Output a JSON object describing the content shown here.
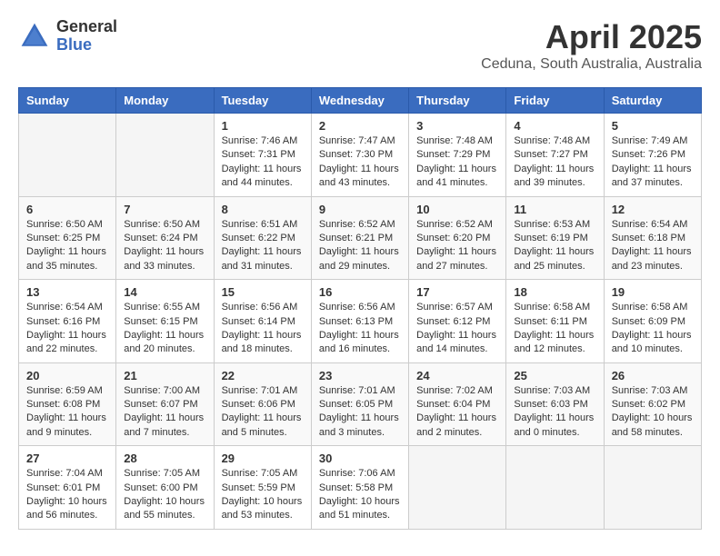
{
  "logo": {
    "general": "General",
    "blue": "Blue"
  },
  "header": {
    "title": "April 2025",
    "subtitle": "Ceduna, South Australia, Australia"
  },
  "weekdays": [
    "Sunday",
    "Monday",
    "Tuesday",
    "Wednesday",
    "Thursday",
    "Friday",
    "Saturday"
  ],
  "weeks": [
    [
      {
        "day": "",
        "detail": ""
      },
      {
        "day": "",
        "detail": ""
      },
      {
        "day": "1",
        "detail": "Sunrise: 7:46 AM\nSunset: 7:31 PM\nDaylight: 11 hours\nand 44 minutes."
      },
      {
        "day": "2",
        "detail": "Sunrise: 7:47 AM\nSunset: 7:30 PM\nDaylight: 11 hours\nand 43 minutes."
      },
      {
        "day": "3",
        "detail": "Sunrise: 7:48 AM\nSunset: 7:29 PM\nDaylight: 11 hours\nand 41 minutes."
      },
      {
        "day": "4",
        "detail": "Sunrise: 7:48 AM\nSunset: 7:27 PM\nDaylight: 11 hours\nand 39 minutes."
      },
      {
        "day": "5",
        "detail": "Sunrise: 7:49 AM\nSunset: 7:26 PM\nDaylight: 11 hours\nand 37 minutes."
      }
    ],
    [
      {
        "day": "6",
        "detail": "Sunrise: 6:50 AM\nSunset: 6:25 PM\nDaylight: 11 hours\nand 35 minutes."
      },
      {
        "day": "7",
        "detail": "Sunrise: 6:50 AM\nSunset: 6:24 PM\nDaylight: 11 hours\nand 33 minutes."
      },
      {
        "day": "8",
        "detail": "Sunrise: 6:51 AM\nSunset: 6:22 PM\nDaylight: 11 hours\nand 31 minutes."
      },
      {
        "day": "9",
        "detail": "Sunrise: 6:52 AM\nSunset: 6:21 PM\nDaylight: 11 hours\nand 29 minutes."
      },
      {
        "day": "10",
        "detail": "Sunrise: 6:52 AM\nSunset: 6:20 PM\nDaylight: 11 hours\nand 27 minutes."
      },
      {
        "day": "11",
        "detail": "Sunrise: 6:53 AM\nSunset: 6:19 PM\nDaylight: 11 hours\nand 25 minutes."
      },
      {
        "day": "12",
        "detail": "Sunrise: 6:54 AM\nSunset: 6:18 PM\nDaylight: 11 hours\nand 23 minutes."
      }
    ],
    [
      {
        "day": "13",
        "detail": "Sunrise: 6:54 AM\nSunset: 6:16 PM\nDaylight: 11 hours\nand 22 minutes."
      },
      {
        "day": "14",
        "detail": "Sunrise: 6:55 AM\nSunset: 6:15 PM\nDaylight: 11 hours\nand 20 minutes."
      },
      {
        "day": "15",
        "detail": "Sunrise: 6:56 AM\nSunset: 6:14 PM\nDaylight: 11 hours\nand 18 minutes."
      },
      {
        "day": "16",
        "detail": "Sunrise: 6:56 AM\nSunset: 6:13 PM\nDaylight: 11 hours\nand 16 minutes."
      },
      {
        "day": "17",
        "detail": "Sunrise: 6:57 AM\nSunset: 6:12 PM\nDaylight: 11 hours\nand 14 minutes."
      },
      {
        "day": "18",
        "detail": "Sunrise: 6:58 AM\nSunset: 6:11 PM\nDaylight: 11 hours\nand 12 minutes."
      },
      {
        "day": "19",
        "detail": "Sunrise: 6:58 AM\nSunset: 6:09 PM\nDaylight: 11 hours\nand 10 minutes."
      }
    ],
    [
      {
        "day": "20",
        "detail": "Sunrise: 6:59 AM\nSunset: 6:08 PM\nDaylight: 11 hours\nand 9 minutes."
      },
      {
        "day": "21",
        "detail": "Sunrise: 7:00 AM\nSunset: 6:07 PM\nDaylight: 11 hours\nand 7 minutes."
      },
      {
        "day": "22",
        "detail": "Sunrise: 7:01 AM\nSunset: 6:06 PM\nDaylight: 11 hours\nand 5 minutes."
      },
      {
        "day": "23",
        "detail": "Sunrise: 7:01 AM\nSunset: 6:05 PM\nDaylight: 11 hours\nand 3 minutes."
      },
      {
        "day": "24",
        "detail": "Sunrise: 7:02 AM\nSunset: 6:04 PM\nDaylight: 11 hours\nand 2 minutes."
      },
      {
        "day": "25",
        "detail": "Sunrise: 7:03 AM\nSunset: 6:03 PM\nDaylight: 11 hours\nand 0 minutes."
      },
      {
        "day": "26",
        "detail": "Sunrise: 7:03 AM\nSunset: 6:02 PM\nDaylight: 10 hours\nand 58 minutes."
      }
    ],
    [
      {
        "day": "27",
        "detail": "Sunrise: 7:04 AM\nSunset: 6:01 PM\nDaylight: 10 hours\nand 56 minutes."
      },
      {
        "day": "28",
        "detail": "Sunrise: 7:05 AM\nSunset: 6:00 PM\nDaylight: 10 hours\nand 55 minutes."
      },
      {
        "day": "29",
        "detail": "Sunrise: 7:05 AM\nSunset: 5:59 PM\nDaylight: 10 hours\nand 53 minutes."
      },
      {
        "day": "30",
        "detail": "Sunrise: 7:06 AM\nSunset: 5:58 PM\nDaylight: 10 hours\nand 51 minutes."
      },
      {
        "day": "",
        "detail": ""
      },
      {
        "day": "",
        "detail": ""
      },
      {
        "day": "",
        "detail": ""
      }
    ]
  ]
}
